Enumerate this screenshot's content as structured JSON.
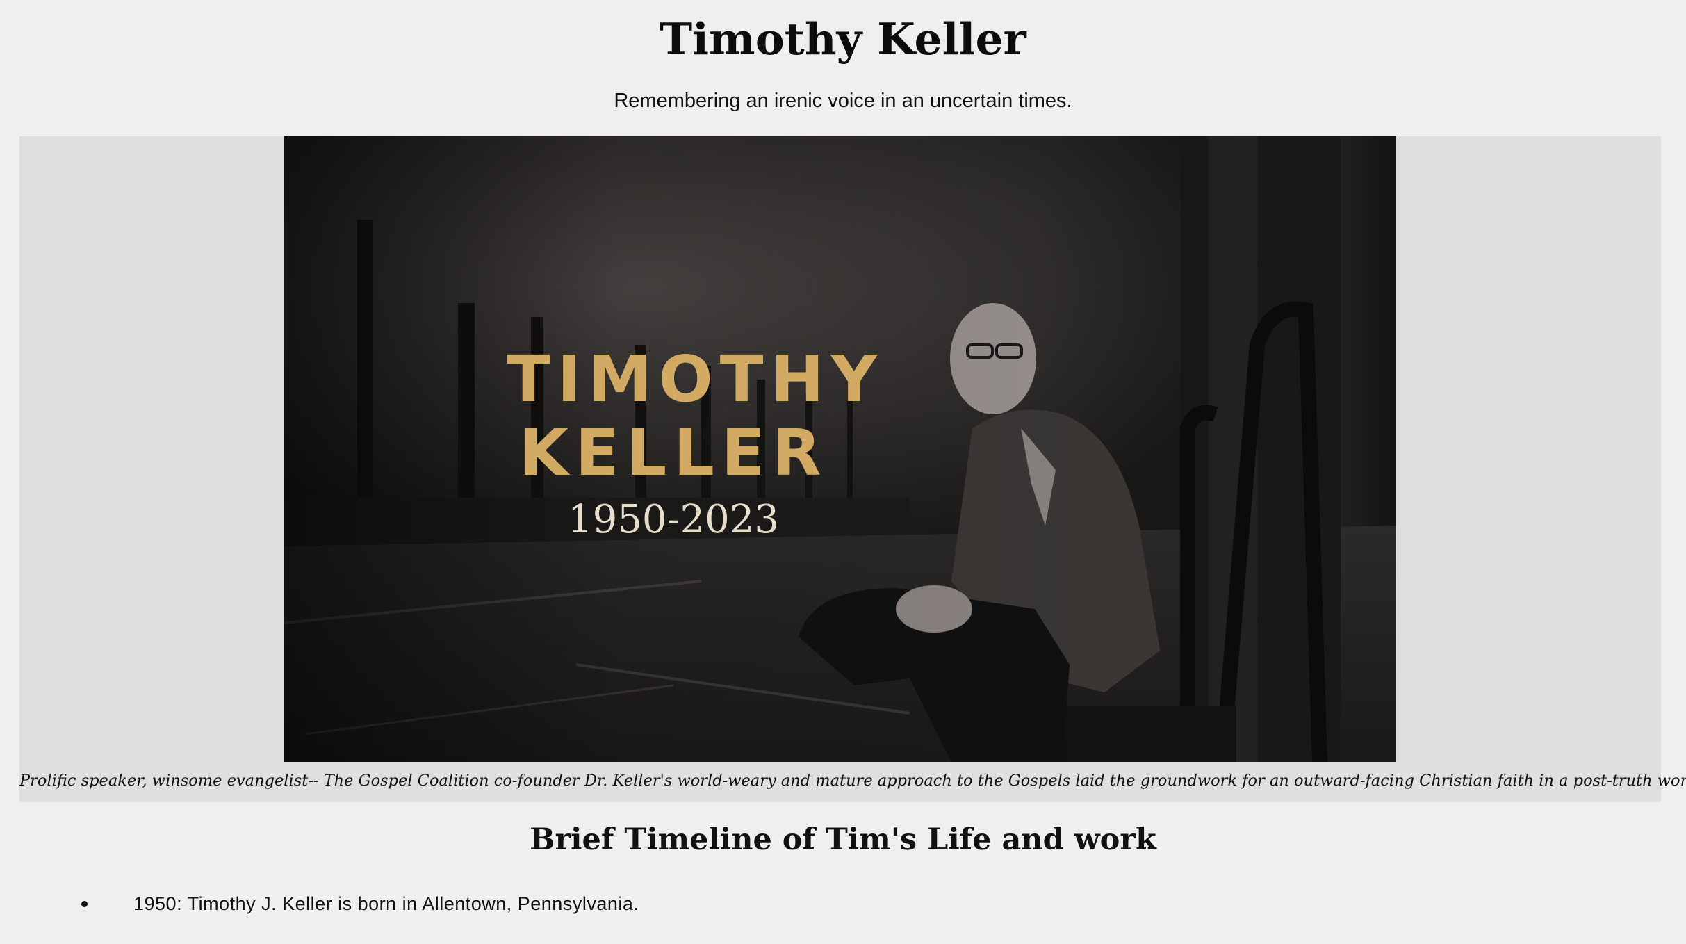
{
  "header": {
    "title": "Timothy Keller",
    "subtitle": "Remembering an irenic voice in an uncertain times."
  },
  "figure": {
    "image_title_line1": "TIMOTHY",
    "image_title_line2": "KELLER",
    "image_years": "1950-2023",
    "caption": "Prolific speaker, winsome evangelist-- The Gospel Coalition co-founder Dr. Keller's world-weary and mature approach to the Gospels laid the groundwork for an outward-facing Christian faith in a post-truth world."
  },
  "timeline": {
    "heading": "Brief Timeline of Tim's Life and work",
    "items": [
      {
        "text": "1950: Timothy J. Keller is born in Allentown, Pennsylvania."
      }
    ]
  },
  "colors": {
    "background": "#efefef",
    "figure_panel": "#dfdfdf",
    "title_gold": "#d2aa64",
    "years_cream": "#e6ddca"
  }
}
